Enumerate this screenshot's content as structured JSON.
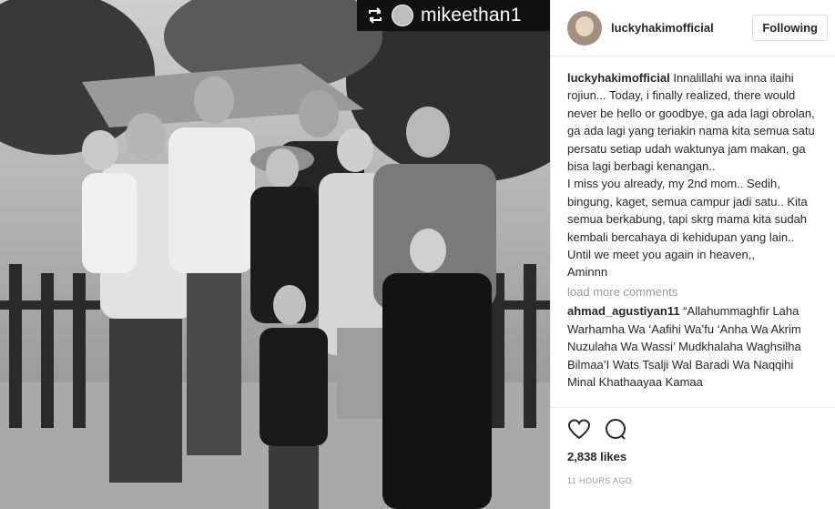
{
  "photo": {
    "repost_user": "mikeethan1",
    "description": "Black and white family photo"
  },
  "post": {
    "author": "luckyhakimofficial",
    "follow_label": "Following",
    "caption": "Innalillahi wa inna ilaihi rojiun... Today, i finally realized, there would never be hello or goodbye, ga ada lagi obrolan, ga ada lagi yang teriakin nama kita semua satu persatu setiap udah waktunya jam makan, ga bisa lagi berbagi kenangan..\nI miss you already, my 2nd mom.. Sedih, bingung, kaget, semua campur jadi satu.. Kita semua berkabung, tapi skrg mama kita sudah kembali bercahaya di kehidupan yang lain.. Until we meet you again in heaven,,\nAminnn",
    "load_more": "load more comments",
    "comment_user": "ahmad_agustiyan11",
    "comment_text": "“Allahummaghfir Laha Warhamha Wa ‘Aafihi Wa’fu ‘Anha Wa Akrim Nuzulaha Wa Wassi’ Mudkhalaha Waghsilha Bilmaa’I Wats Tsalji Wal Baradi Wa Naqqihi Minal Khathaayaa Kamaa",
    "likes": "2,838 likes",
    "time": "11 HOURS AGO"
  },
  "icons": {
    "repost": "repost-icon",
    "like": "heart-icon",
    "comment": "comment-icon"
  }
}
